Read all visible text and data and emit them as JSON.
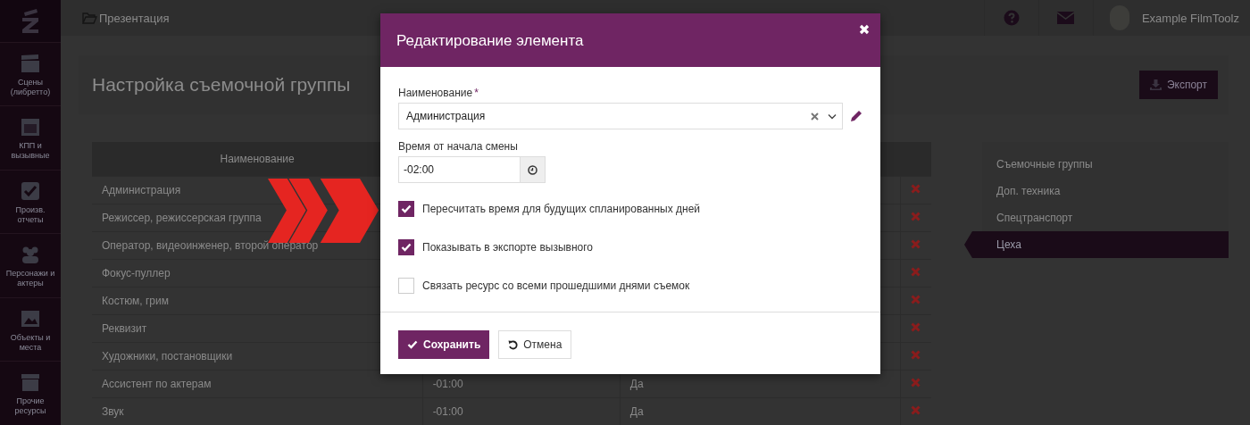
{
  "sidebar": {
    "items": [
      {
        "label": "Сцены (либретто)"
      },
      {
        "label": "КПП и вызывные"
      },
      {
        "label": "Произв. отчеты"
      },
      {
        "label": "Персонажи и актеры"
      },
      {
        "label": "Объекты и места"
      },
      {
        "label": "Прочие ресурсы"
      }
    ]
  },
  "topbar": {
    "breadcrumb": "Презентация",
    "user": "Example FilmToolz"
  },
  "page": {
    "title": "Настройка съемочной группы",
    "export_button": "Экспорт"
  },
  "table": {
    "columns": [
      "Наименование"
    ],
    "rows": [
      {
        "name": "Администрация"
      },
      {
        "name": "Режиссер, режиссерская группа"
      },
      {
        "name": "Оператор, видеоинженер, второй оператор"
      },
      {
        "name": "Фокус-пуллер"
      },
      {
        "name": "Костюм, грим"
      },
      {
        "name": "Реквизит"
      },
      {
        "name": "Художники, постановщики"
      },
      {
        "name": "Ассистент по актерам",
        "time": "-01:00",
        "show": "Да"
      },
      {
        "name": "Звук",
        "time": "-01:00",
        "show": "Да"
      }
    ]
  },
  "side_menu": [
    {
      "label": "Съемочные группы",
      "selected": false
    },
    {
      "label": "Доп. техника",
      "selected": false
    },
    {
      "label": "Спецтранспорт",
      "selected": false
    },
    {
      "label": "Цеха",
      "selected": true
    }
  ],
  "dialog": {
    "title": "Редактирование элемента",
    "name_label": "Наименование",
    "name_required_mark": "*",
    "name_value": "Администрация",
    "time_label": "Время от начала смены",
    "time_value": "-02:00",
    "checkboxes": [
      {
        "label": "Пересчитать время для будущих спланированных дней",
        "checked": true
      },
      {
        "label": "Показывать в экспорте вызывного",
        "checked": true
      },
      {
        "label": "Связать ресурс со всеми прошедшими днями съемок",
        "checked": false
      }
    ],
    "save_button": "Сохранить",
    "cancel_button": "Отмена"
  }
}
